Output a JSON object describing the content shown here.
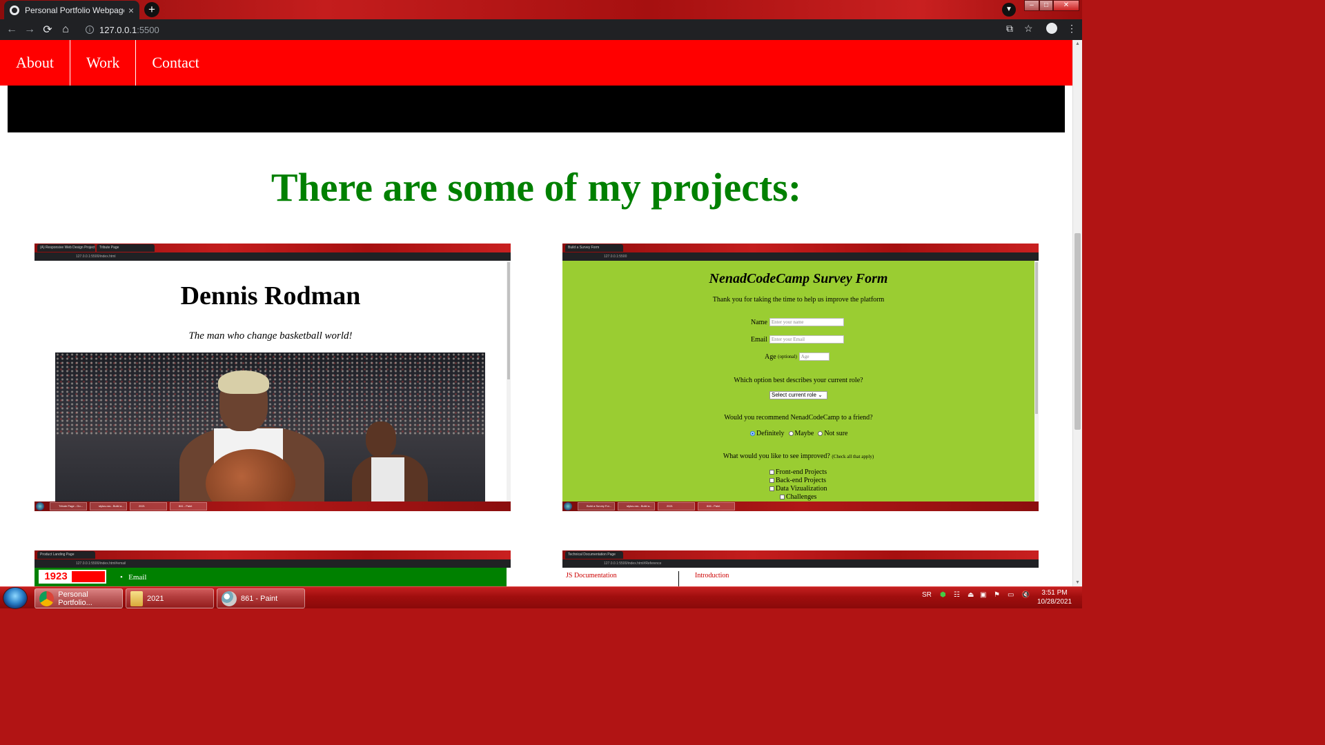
{
  "browser": {
    "tab_title": "Personal Portfolio Webpage",
    "tab_close": "×",
    "new_tab": "+",
    "url_host": "127.0.0.1",
    "url_port": ":5500"
  },
  "site": {
    "nav": [
      {
        "label": "About"
      },
      {
        "label": "Work"
      },
      {
        "label": "Contact"
      }
    ],
    "projects_heading": "There are some of my projects:"
  },
  "projects": {
    "rodman": {
      "tab1": "(A) Responsive Web Design Project",
      "tab2": "Tribute Page",
      "url": "127.0.0.1:5500/index.html",
      "heading": "Dennis Rodman",
      "subtitle": "The man who change basketball world!",
      "taskbar": [
        "Tribute Page - Go...",
        "stylus.css - Build a...",
        "2021",
        "841 - Paint"
      ]
    },
    "survey": {
      "tab1": "Build a Survey Form",
      "url": "127.0.0.1:5500",
      "title": "NenadCodeCamp Survey Form",
      "description": "Thank you for taking the time to help us improve the platform",
      "name_label": "Name",
      "name_placeholder": "Enter your name",
      "email_label": "Email",
      "email_placeholder": "Enter your Email",
      "age_label": "Age",
      "age_optional": "(optional)",
      "age_placeholder": "Age",
      "role_question": "Which option best describes your current role?",
      "role_select": "Select current role",
      "recommend_question": "Would you recommend NenadCodeCamp to a friend?",
      "recommend_options": [
        "Definitely",
        "Maybe",
        "Not sure"
      ],
      "improve_question": "What would you like to see improved?",
      "improve_hint": "(Check all that apply)",
      "improve_options": [
        "Front-end Projects",
        "Back-end Projects",
        "Data Vizualization",
        "Challenges"
      ],
      "taskbar": [
        "Build a Survey For...",
        "stylus.css - Build a...",
        "2021",
        "846 - Paint"
      ]
    },
    "landing": {
      "tab1": "Product Landing Page",
      "url": "127.0.0.1:5500/index.html#email",
      "logo": "1923",
      "email_link": "Email"
    },
    "docs": {
      "tab1": "Technical Documentation Page",
      "url": "127.0.0.1:5500/index.html#Reference",
      "left_label": "JS Documentation",
      "right_label": "Introduction"
    }
  },
  "taskbar": {
    "items": [
      {
        "label": "Personal Portfolio...",
        "icon": "chrome-icon"
      },
      {
        "label": "2021",
        "icon": "folder-icon"
      },
      {
        "label": "861 - Paint",
        "icon": "paint-icon"
      }
    ],
    "language": "SR",
    "time": "3:51 PM",
    "date": "10/28/2021"
  }
}
